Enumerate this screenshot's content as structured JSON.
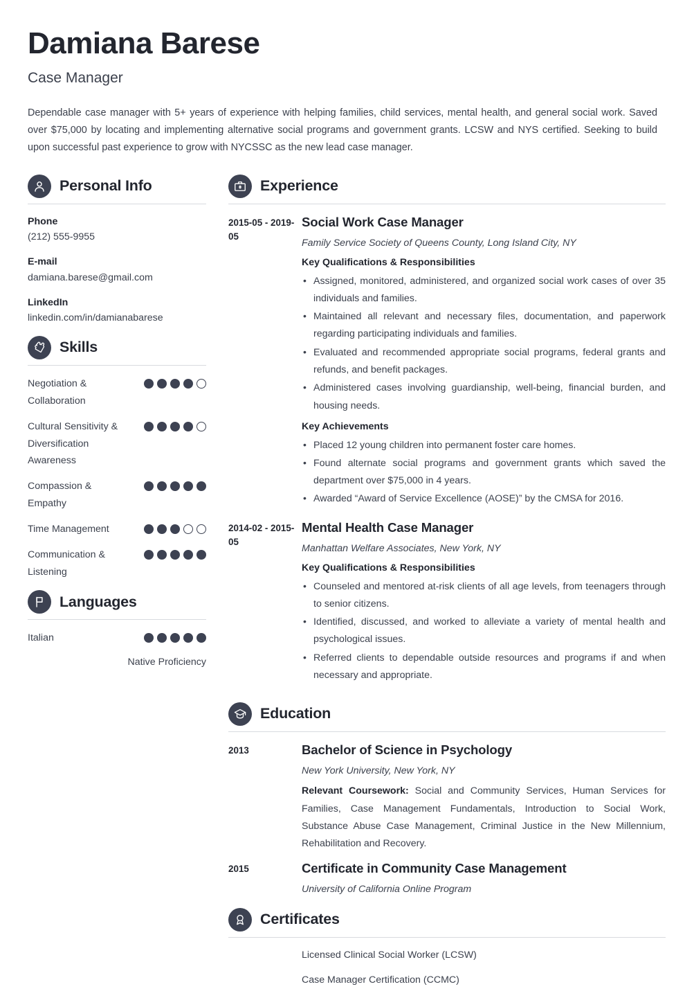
{
  "header": {
    "name": "Damiana Barese",
    "job_title": "Case Manager",
    "summary": "Dependable case manager with 5+ years of experience with helping families, child services, mental health, and general social work. Saved over $75,000 by locating and implementing alternative social programs and government grants. LCSW and NYS certified. Seeking to build upon successful past experience to grow with NYCSSC as the new lead case manager."
  },
  "personal_info": {
    "section_title": "Personal Info",
    "icon": "person-icon",
    "items": [
      {
        "label": "Phone",
        "value": "(212) 555-9955"
      },
      {
        "label": "E-mail",
        "value": "damiana.barese@gmail.com"
      },
      {
        "label": "LinkedIn",
        "value": "linkedin.com/in/damianabarese"
      }
    ]
  },
  "skills": {
    "section_title": "Skills",
    "icon": "puzzle-piece-icon",
    "max_rating": 5,
    "items": [
      {
        "name": "Negotiation & Collaboration",
        "rating": 4
      },
      {
        "name": "Cultural Sensitivity & Diversification Awareness",
        "rating": 4
      },
      {
        "name": "Compassion & Empathy",
        "rating": 5
      },
      {
        "name": "Time Management",
        "rating": 3
      },
      {
        "name": "Communication & Listening",
        "rating": 5
      }
    ]
  },
  "languages": {
    "section_title": "Languages",
    "icon": "flag-icon",
    "max_rating": 5,
    "items": [
      {
        "name": "Italian",
        "rating": 5,
        "level": "Native Proficiency"
      }
    ]
  },
  "experience": {
    "section_title": "Experience",
    "icon": "briefcase-icon",
    "entries": [
      {
        "date": "2015-05 - 2019-05",
        "title": "Social Work Case Manager",
        "subtitle": "Family Service Society of Queens County, Long Island City, NY",
        "groups": [
          {
            "heading": "Key Qualifications & Responsibilities",
            "bullets": [
              "Assigned, monitored, administered, and organized social work cases of over 35 individuals and families.",
              "Maintained all relevant and necessary files, documentation, and paperwork regarding participating individuals and families.",
              "Evaluated and recommended appropriate social programs, federal grants and refunds, and benefit packages.",
              "Administered cases involving guardianship, well-being, financial burden, and housing needs."
            ]
          },
          {
            "heading": "Key Achievements",
            "bullets": [
              "Placed 12 young children into permanent foster care homes.",
              "Found alternate social programs and government grants which saved the department over $75,000 in 4 years.",
              "Awarded “Award of Service Excellence (AOSE)” by the CMSA for 2016."
            ]
          }
        ]
      },
      {
        "date": "2014-02 - 2015-05",
        "title": "Mental Health Case Manager",
        "subtitle": "Manhattan Welfare Associates, New York, NY",
        "groups": [
          {
            "heading": "Key Qualifications & Responsibilities",
            "bullets": [
              "Counseled and mentored at-risk clients of all age levels, from teenagers through to senior citizens.",
              "Identified, discussed, and worked to alleviate a variety of mental health and psychological issues.",
              "Referred clients to dependable outside resources and programs if and when necessary and appropriate."
            ]
          }
        ]
      }
    ]
  },
  "education": {
    "section_title": "Education",
    "icon": "graduation-cap-icon",
    "entries": [
      {
        "date": "2013",
        "title": "Bachelor of Science in Psychology",
        "subtitle": "New York University, New York, NY",
        "detail_label": "Relevant Coursework:",
        "detail_text": " Social and Community Services, Human Services for Families, Case Management Fundamentals, Introduction to Social Work, Substance Abuse Case Management, Criminal Justice in the New Millennium, Rehabilitation and Recovery."
      },
      {
        "date": "2015",
        "title": "Certificate in Community Case Management",
        "subtitle": "University of California Online Program",
        "detail_label": "",
        "detail_text": ""
      }
    ]
  },
  "certificates": {
    "section_title": "Certificates",
    "icon": "award-ribbon-icon",
    "items": [
      "Licensed Clinical Social Worker (LCSW)",
      "Case Manager Certification (CCMC)"
    ]
  },
  "colors": {
    "accent_dark": "#3d4252",
    "heading": "#23262f",
    "body_text": "#3c414d",
    "rule": "#d8dadf"
  }
}
